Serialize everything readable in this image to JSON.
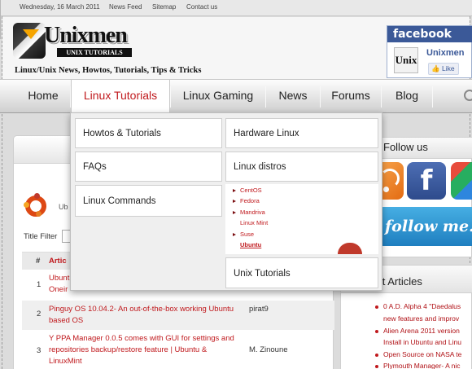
{
  "topbar": {
    "date": "Wednesday, 16 March 2011",
    "links": [
      "News Feed",
      "Sitemap",
      "Contact us"
    ]
  },
  "logo": {
    "word": "Unixmen",
    "sub": "UNIX TUTORIALS"
  },
  "tagline": "Linux/Unix News, Howtos, Tutorials, Tips & Tricks",
  "facebook_box": {
    "brand": "facebook",
    "thumb": "Unix",
    "page_name": "Unixmen",
    "like_label": "Like",
    "brand_color": "#3b5998"
  },
  "nav": {
    "items": [
      "Home",
      "Linux Tutorials",
      "Linux Gaming",
      "News",
      "Forums",
      "Blog"
    ],
    "active": "Linux Tutorials",
    "accent_color": "#c0191d"
  },
  "dropdown": {
    "left_tiles": [
      "Howtos & Tutorials",
      "FAQs",
      "Linux Commands"
    ],
    "right_tiles": [
      "Hardware Linux",
      "Linux distros",
      "Unix Tutorials"
    ],
    "distros": [
      {
        "label": "CentOS",
        "arrow": true
      },
      {
        "label": "Fedora",
        "arrow": true
      },
      {
        "label": "Mandriva",
        "arrow": true
      },
      {
        "label": "Linux Mint",
        "arrow": false
      },
      {
        "label": "Suse",
        "arrow": true
      },
      {
        "label": "Ubuntu",
        "arrow": false,
        "current": true
      }
    ]
  },
  "content": {
    "category_label": "Ub",
    "title_filter_label": "Title Filter",
    "table": {
      "headers": [
        "#",
        "Artic"
      ],
      "rows": [
        {
          "num": "1",
          "title": "Ubunt\nOneir",
          "author": ""
        },
        {
          "num": "2",
          "title": "Pinguy OS 10.04.2- An out-of-the-box working Ubuntu based OS",
          "author": "pirat9"
        },
        {
          "num": "3",
          "title": "Y PPA Manager 0.0.5 comes with GUI for settings and repositories backup/restore feature | Ubuntu & LinuxMint",
          "author": "M. Zinoune"
        }
      ]
    }
  },
  "sidebar": {
    "follow_title": "Follow us",
    "follow_banner": "follow me...",
    "latest_title": "est Articles",
    "latest": [
      "0 A.D. Alpha 4 \"Daedalus",
      "new features and improv",
      "Alien Arena 2011 version",
      "Install in Ubuntu and Linu",
      "Open Source on NASA te",
      "Plymouth Manager- A nic"
    ]
  }
}
